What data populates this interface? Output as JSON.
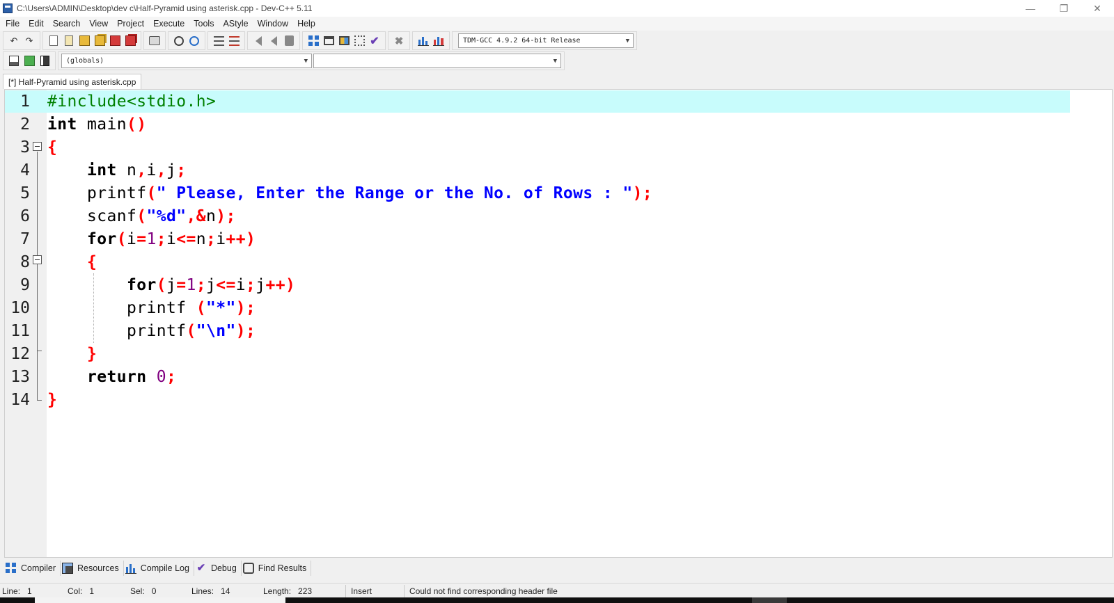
{
  "window": {
    "title": "C:\\Users\\ADMIN\\Desktop\\dev c\\Half-Pyramid using asterisk.cpp - Dev-C++ 5.11",
    "minimize": "—",
    "restore": "❐",
    "close": "✕"
  },
  "menu": [
    "File",
    "Edit",
    "Search",
    "View",
    "Project",
    "Execute",
    "Tools",
    "AStyle",
    "Window",
    "Help"
  ],
  "toolbar": {
    "compiler_selected": "TDM-GCC 4.9.2 64-bit Release",
    "scope_selected": "(globals)",
    "member_selected": ""
  },
  "editor": {
    "tab_label": "[*] Half-Pyramid using asterisk.cpp",
    "lines": [
      [
        {
          "t": "#include<stdio.h>",
          "c": "pre"
        }
      ],
      [
        {
          "t": "int",
          "c": "kw"
        },
        {
          "t": " main",
          "c": "id"
        },
        {
          "t": "()",
          "c": "sym"
        }
      ],
      [
        {
          "t": "{",
          "c": "sym"
        }
      ],
      [
        {
          "t": "    ",
          "c": "id"
        },
        {
          "t": "int",
          "c": "kw"
        },
        {
          "t": " n",
          "c": "id"
        },
        {
          "t": ",",
          "c": "sym"
        },
        {
          "t": "i",
          "c": "id"
        },
        {
          "t": ",",
          "c": "sym"
        },
        {
          "t": "j",
          "c": "id"
        },
        {
          "t": ";",
          "c": "sym"
        }
      ],
      [
        {
          "t": "    printf",
          "c": "id"
        },
        {
          "t": "(",
          "c": "sym"
        },
        {
          "t": "\" Please, Enter the Range or the No. of Rows : \"",
          "c": "str"
        },
        {
          "t": ");",
          "c": "sym"
        }
      ],
      [
        {
          "t": "    scanf",
          "c": "id"
        },
        {
          "t": "(",
          "c": "sym"
        },
        {
          "t": "\"%d\"",
          "c": "str"
        },
        {
          "t": ",&",
          "c": "sym"
        },
        {
          "t": "n",
          "c": "id"
        },
        {
          "t": ");",
          "c": "sym"
        }
      ],
      [
        {
          "t": "    ",
          "c": "id"
        },
        {
          "t": "for",
          "c": "kw"
        },
        {
          "t": "(",
          "c": "sym"
        },
        {
          "t": "i",
          "c": "id"
        },
        {
          "t": "=",
          "c": "sym"
        },
        {
          "t": "1",
          "c": "num"
        },
        {
          "t": ";",
          "c": "sym"
        },
        {
          "t": "i",
          "c": "id"
        },
        {
          "t": "<=",
          "c": "sym"
        },
        {
          "t": "n",
          "c": "id"
        },
        {
          "t": ";",
          "c": "sym"
        },
        {
          "t": "i",
          "c": "id"
        },
        {
          "t": "++)",
          "c": "sym"
        }
      ],
      [
        {
          "t": "    ",
          "c": "id"
        },
        {
          "t": "{",
          "c": "sym"
        }
      ],
      [
        {
          "t": "        ",
          "c": "id"
        },
        {
          "t": "for",
          "c": "kw"
        },
        {
          "t": "(",
          "c": "sym"
        },
        {
          "t": "j",
          "c": "id"
        },
        {
          "t": "=",
          "c": "sym"
        },
        {
          "t": "1",
          "c": "num"
        },
        {
          "t": ";",
          "c": "sym"
        },
        {
          "t": "j",
          "c": "id"
        },
        {
          "t": "<=",
          "c": "sym"
        },
        {
          "t": "i",
          "c": "id"
        },
        {
          "t": ";",
          "c": "sym"
        },
        {
          "t": "j",
          "c": "id"
        },
        {
          "t": "++)",
          "c": "sym"
        }
      ],
      [
        {
          "t": "        printf ",
          "c": "id"
        },
        {
          "t": "(",
          "c": "sym"
        },
        {
          "t": "\"*\"",
          "c": "str"
        },
        {
          "t": ");",
          "c": "sym"
        }
      ],
      [
        {
          "t": "        printf",
          "c": "id"
        },
        {
          "t": "(",
          "c": "sym"
        },
        {
          "t": "\"\\n\"",
          "c": "str"
        },
        {
          "t": ");",
          "c": "sym"
        }
      ],
      [
        {
          "t": "    ",
          "c": "id"
        },
        {
          "t": "}",
          "c": "sym"
        }
      ],
      [
        {
          "t": "    ",
          "c": "id"
        },
        {
          "t": "return",
          "c": "kw"
        },
        {
          "t": " ",
          "c": "id"
        },
        {
          "t": "0",
          "c": "num"
        },
        {
          "t": ";",
          "c": "sym"
        }
      ],
      [
        {
          "t": "}",
          "c": "sym"
        }
      ]
    ]
  },
  "bottom_tabs": [
    {
      "label": "Compiler",
      "icon": "compiler-icon"
    },
    {
      "label": "Resources",
      "icon": "resources-icon"
    },
    {
      "label": "Compile Log",
      "icon": "compile-log-icon"
    },
    {
      "label": "Debug",
      "icon": "debug-icon"
    },
    {
      "label": "Find Results",
      "icon": "find-results-icon"
    }
  ],
  "status": {
    "line_label": "Line:",
    "line_value": "1",
    "col_label": "Col:",
    "col_value": "1",
    "sel_label": "Sel:",
    "sel_value": "0",
    "lines_label": "Lines:",
    "lines_value": "14",
    "length_label": "Length:",
    "length_value": "223",
    "mode": "Insert",
    "message": "Could not find corresponding header file"
  },
  "colors": {
    "current_line": "#c8fcfc",
    "keyword": "#000000",
    "symbol": "#ff0000",
    "string": "#0000ff",
    "number": "#800080",
    "preprocessor": "#008000"
  }
}
